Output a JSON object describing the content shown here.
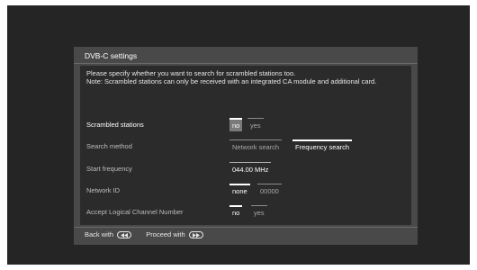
{
  "panel": {
    "title": "DVB-C settings",
    "description_line1": "Please specify whether you want to search for scrambled stations too.",
    "description_line2": "Note: Scrambled stations can only be received with an integrated CA module and additional card."
  },
  "rows": [
    {
      "label": "Scrambled stations",
      "options": [
        "no",
        "yes"
      ],
      "selected": "no"
    },
    {
      "label": "Search method",
      "options": [
        "Network search",
        "Frequency search"
      ],
      "selected": "Frequency search"
    },
    {
      "label": "Start frequency",
      "value": "044.00 MHz"
    },
    {
      "label": "Network ID",
      "options": [
        "none",
        "00000"
      ],
      "selected": "none"
    },
    {
      "label": "Accept Logical Channel Number",
      "options": [
        "no",
        "yes"
      ],
      "selected": "no"
    }
  ],
  "footer": {
    "back_label": "Back with",
    "back_icon": "rewind-button-icon",
    "proceed_label": "Proceed with",
    "proceed_icon": "fast-forward-button-icon"
  },
  "colors": {
    "screen_bg": "#252525",
    "panel_bg": "#494949",
    "inner_bg": "#2b2b2b",
    "highlight": "#7a7a7a"
  }
}
